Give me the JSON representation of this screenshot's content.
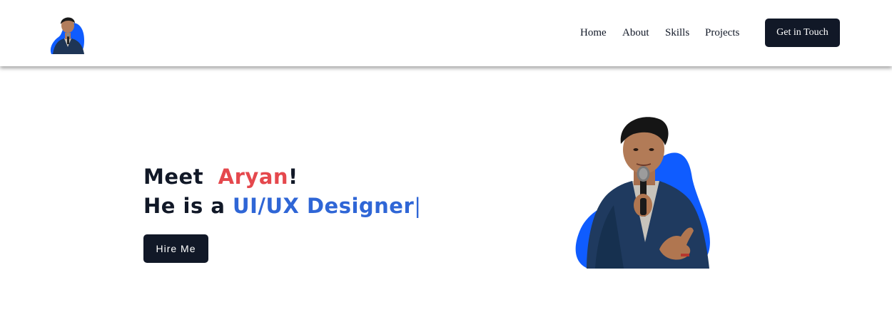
{
  "nav": {
    "logo_icon": "portrait-logo-icon",
    "links": [
      "Home",
      "About",
      "Skills",
      "Projects"
    ],
    "cta_label": "Get in Touch"
  },
  "hero": {
    "meet_label": "Meet",
    "name": "Aryan",
    "exclaim": "!",
    "intro": "He is a",
    "role": "UI/UX Designer",
    "caret": "|",
    "hire_label": "Hire Me",
    "portrait_icon": "speaker-portrait-image"
  },
  "colors": {
    "dark": "#111827",
    "name_red": "#e5484d",
    "role_blue": "#2f66d6",
    "blob_blue": "#0f5cff"
  }
}
